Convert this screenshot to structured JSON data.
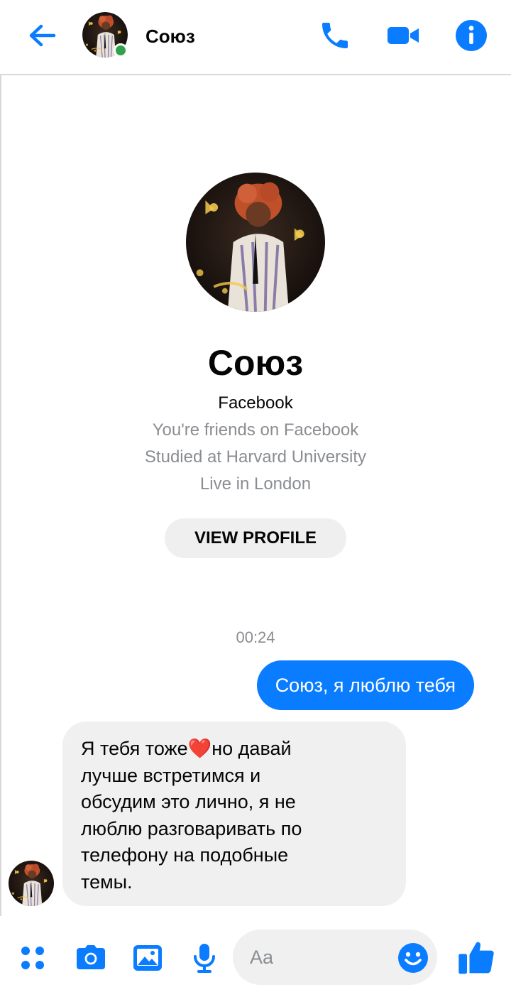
{
  "header": {
    "contact_name": "Союз",
    "status": "online",
    "icons": [
      "back-arrow-icon",
      "phone-icon",
      "video-camera-icon",
      "info-icon"
    ]
  },
  "profile": {
    "name": "Союз",
    "source": "Facebook",
    "details": [
      "You're friends on Facebook",
      "Studied at Harvard University",
      "Live in London"
    ],
    "view_profile_label": "VIEW PROFILE"
  },
  "conversation": {
    "timestamp": "00:24",
    "messages": [
      {
        "direction": "outgoing",
        "text": "Союз, я люблю тебя"
      },
      {
        "direction": "incoming",
        "text": "Я тебя тоже❤️но давай\nлучше встретимся и\nобсудим это лично, я не\nлюблю разговаривать по\nтелефону на подобные\nтемы."
      }
    ]
  },
  "composer": {
    "placeholder": "Aa",
    "icons": [
      "apps-icon",
      "camera-icon",
      "gallery-icon",
      "microphone-icon",
      "emoji-icon",
      "thumbs-up-icon"
    ]
  },
  "colors": {
    "accent": "#0a7cff",
    "online": "#31a24c",
    "bubble_incoming": "#f0f0f0",
    "muted_text": "#8a8d91"
  }
}
